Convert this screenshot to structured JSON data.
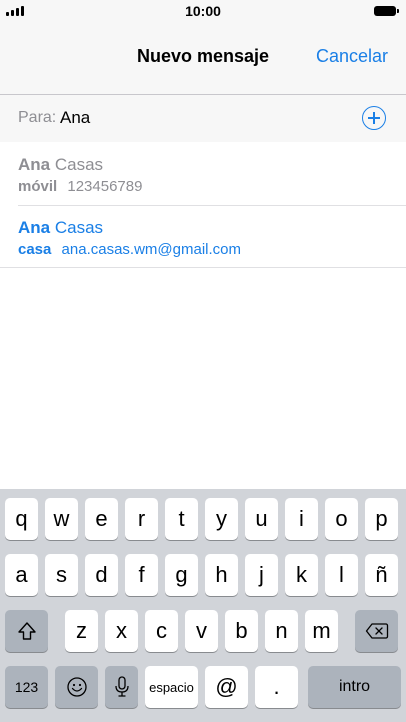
{
  "status_bar": {
    "time": "10:00"
  },
  "nav": {
    "title": "Nuevo mensaje",
    "cancel": "Cancelar"
  },
  "to_field": {
    "label": "Para:",
    "value": "Ana"
  },
  "contacts": [
    {
      "first": "Ana",
      "last": "Casas",
      "detail_type": "móvil",
      "detail": "123456789",
      "state": "disabled"
    },
    {
      "first": "Ana",
      "last": "Casas",
      "detail_type": "casa",
      "detail": "ana.casas.wm@gmail.com",
      "state": "active"
    }
  ],
  "keyboard": {
    "row1": [
      "q",
      "w",
      "e",
      "r",
      "t",
      "y",
      "u",
      "i",
      "o",
      "p"
    ],
    "row2": [
      "a",
      "s",
      "d",
      "f",
      "g",
      "h",
      "j",
      "k",
      "l",
      "ñ"
    ],
    "row3": [
      "z",
      "x",
      "c",
      "v",
      "b",
      "n",
      "m"
    ],
    "numbers": "123",
    "space": "espacio",
    "at": "@",
    "dot": ".",
    "return": "intro"
  },
  "colors": {
    "accent": "#1a7fe6",
    "muted": "#8e8e93",
    "keyboard_bg": "#d1d4d9"
  }
}
